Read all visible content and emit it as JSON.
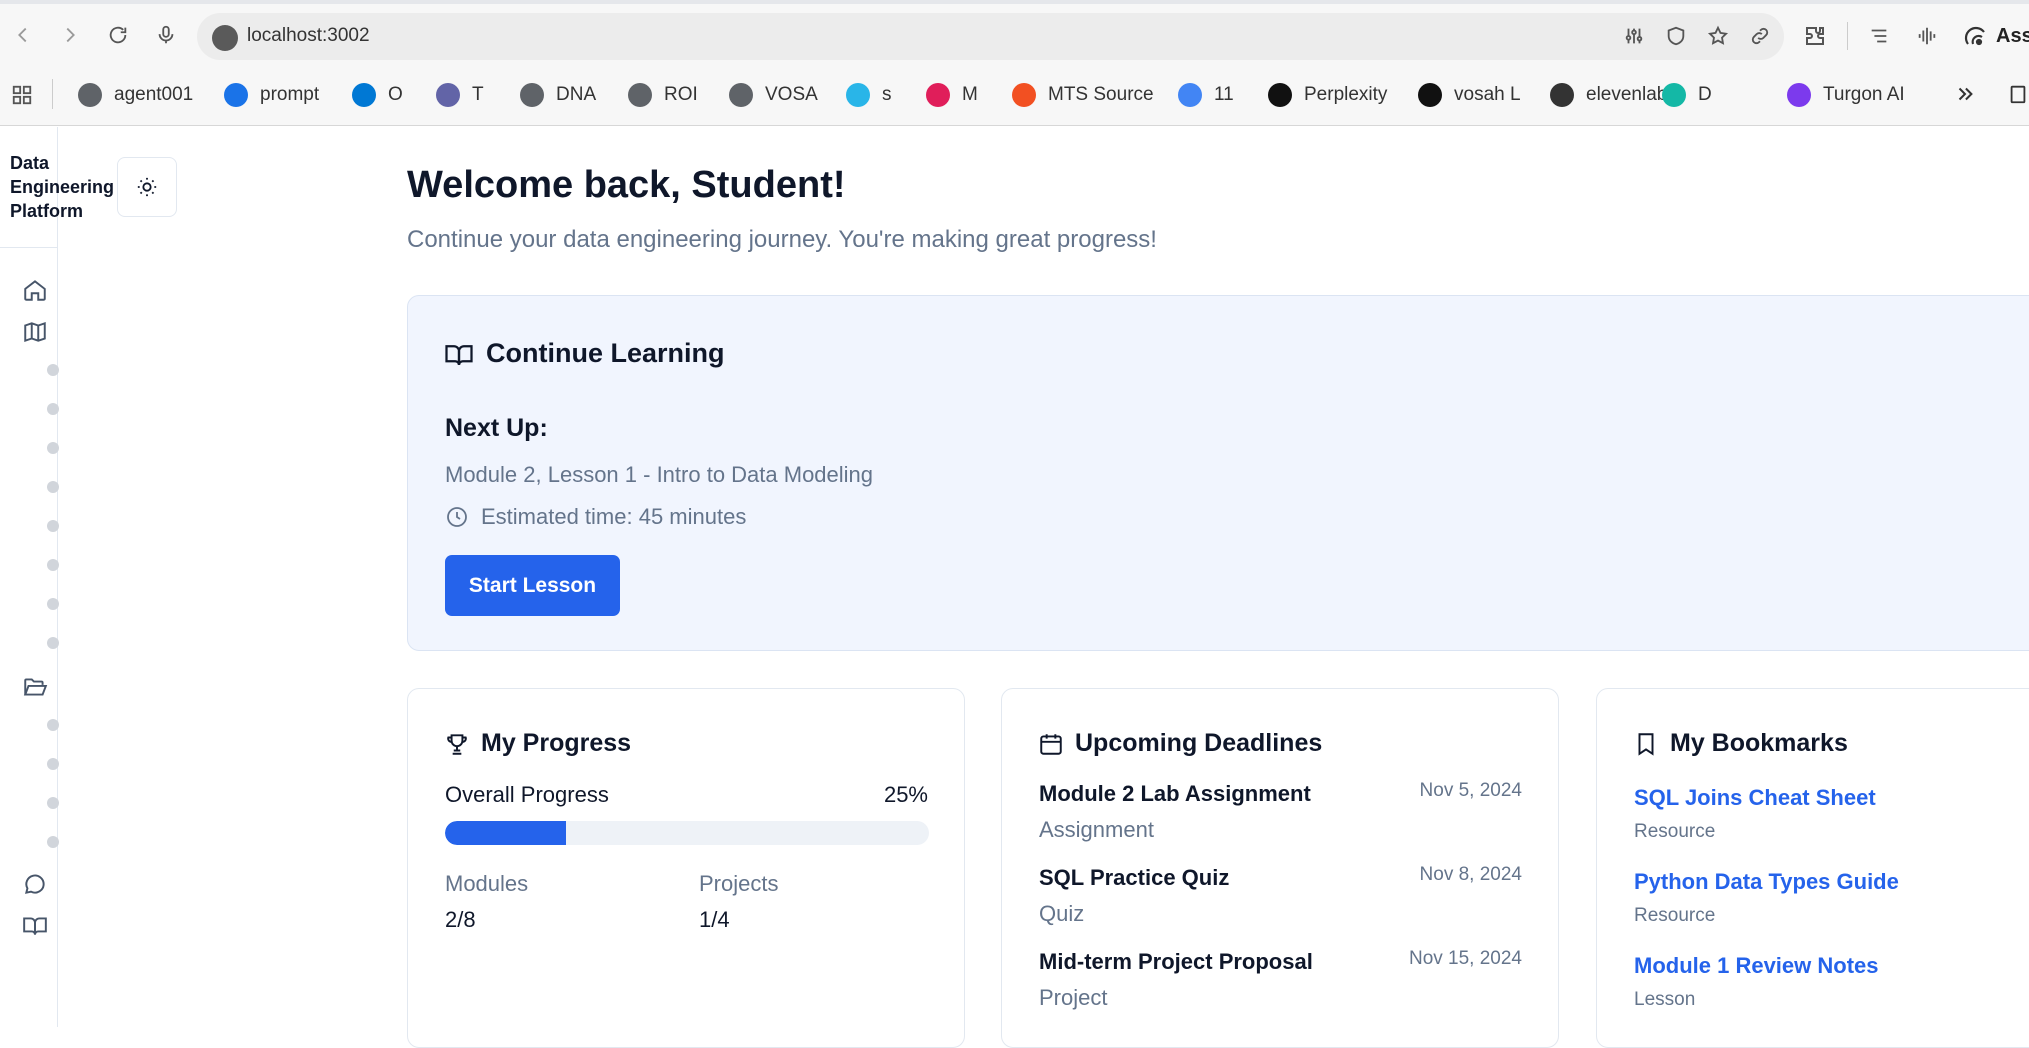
{
  "browser": {
    "url": "localhost:3002",
    "assistant_label": "Assi",
    "bookmarks": [
      {
        "label": "agent001",
        "color": "#5f6368"
      },
      {
        "label": "prompt",
        "color": "#1a73e8"
      },
      {
        "label": "O",
        "color": "#0078d4"
      },
      {
        "label": "T",
        "color": "#6264a7"
      },
      {
        "label": "DNA",
        "color": "#5f6368"
      },
      {
        "label": "ROI",
        "color": "#5f6368"
      },
      {
        "label": "VOSA",
        "color": "#5f6368"
      },
      {
        "label": "s",
        "color": "#29b5e8"
      },
      {
        "label": "M",
        "color": "#e01e5a"
      },
      {
        "label": "MTS Source",
        "color": "#f25022"
      },
      {
        "label": "11",
        "color": "#4285f4"
      },
      {
        "label": "Perplexity",
        "color": "#111111"
      },
      {
        "label": "vosah L",
        "color": "#111111"
      },
      {
        "label": "elevenlabs",
        "color": "#333333"
      },
      {
        "label": "D",
        "color": "#14b8a6"
      },
      {
        "label": "Turgon AI",
        "color": "#7c3aed"
      }
    ]
  },
  "sidebar": {
    "brand": "Data Engineering Platform"
  },
  "header": {
    "title": "Welcome back, Student!",
    "subtitle": "Continue your data engineering journey. You're making great progress!"
  },
  "continue_learning": {
    "title": "Continue Learning",
    "next_up_label": "Next Up:",
    "lesson": "Module 2, Lesson 1 - Intro to Data Modeling",
    "estimate": "Estimated time: 45 minutes",
    "button": "Start Lesson"
  },
  "progress": {
    "title": "My Progress",
    "overall_label": "Overall Progress",
    "overall_pct_text": "25%",
    "overall_fraction": 0.25,
    "modules_label": "Modules",
    "modules_value": "2/8",
    "projects_label": "Projects",
    "projects_value": "1/4"
  },
  "deadlines": {
    "title": "Upcoming Deadlines",
    "items": [
      {
        "name": "Module 2 Lab Assignment",
        "type": "Assignment",
        "date": "Nov 5, 2024"
      },
      {
        "name": "SQL Practice Quiz",
        "type": "Quiz",
        "date": "Nov 8, 2024"
      },
      {
        "name": "Mid-term Project Proposal",
        "type": "Project",
        "date": "Nov 15, 2024"
      }
    ]
  },
  "bookmarks_card": {
    "title": "My Bookmarks",
    "items": [
      {
        "name": "SQL Joins Cheat Sheet",
        "type": "Resource"
      },
      {
        "name": "Python Data Types Guide",
        "type": "Resource"
      },
      {
        "name": "Module 1 Review Notes",
        "type": "Lesson"
      }
    ]
  },
  "colors": {
    "accent": "#2563eb",
    "muted_text": "#64748b",
    "card_highlight_bg": "#f1f5fe"
  }
}
